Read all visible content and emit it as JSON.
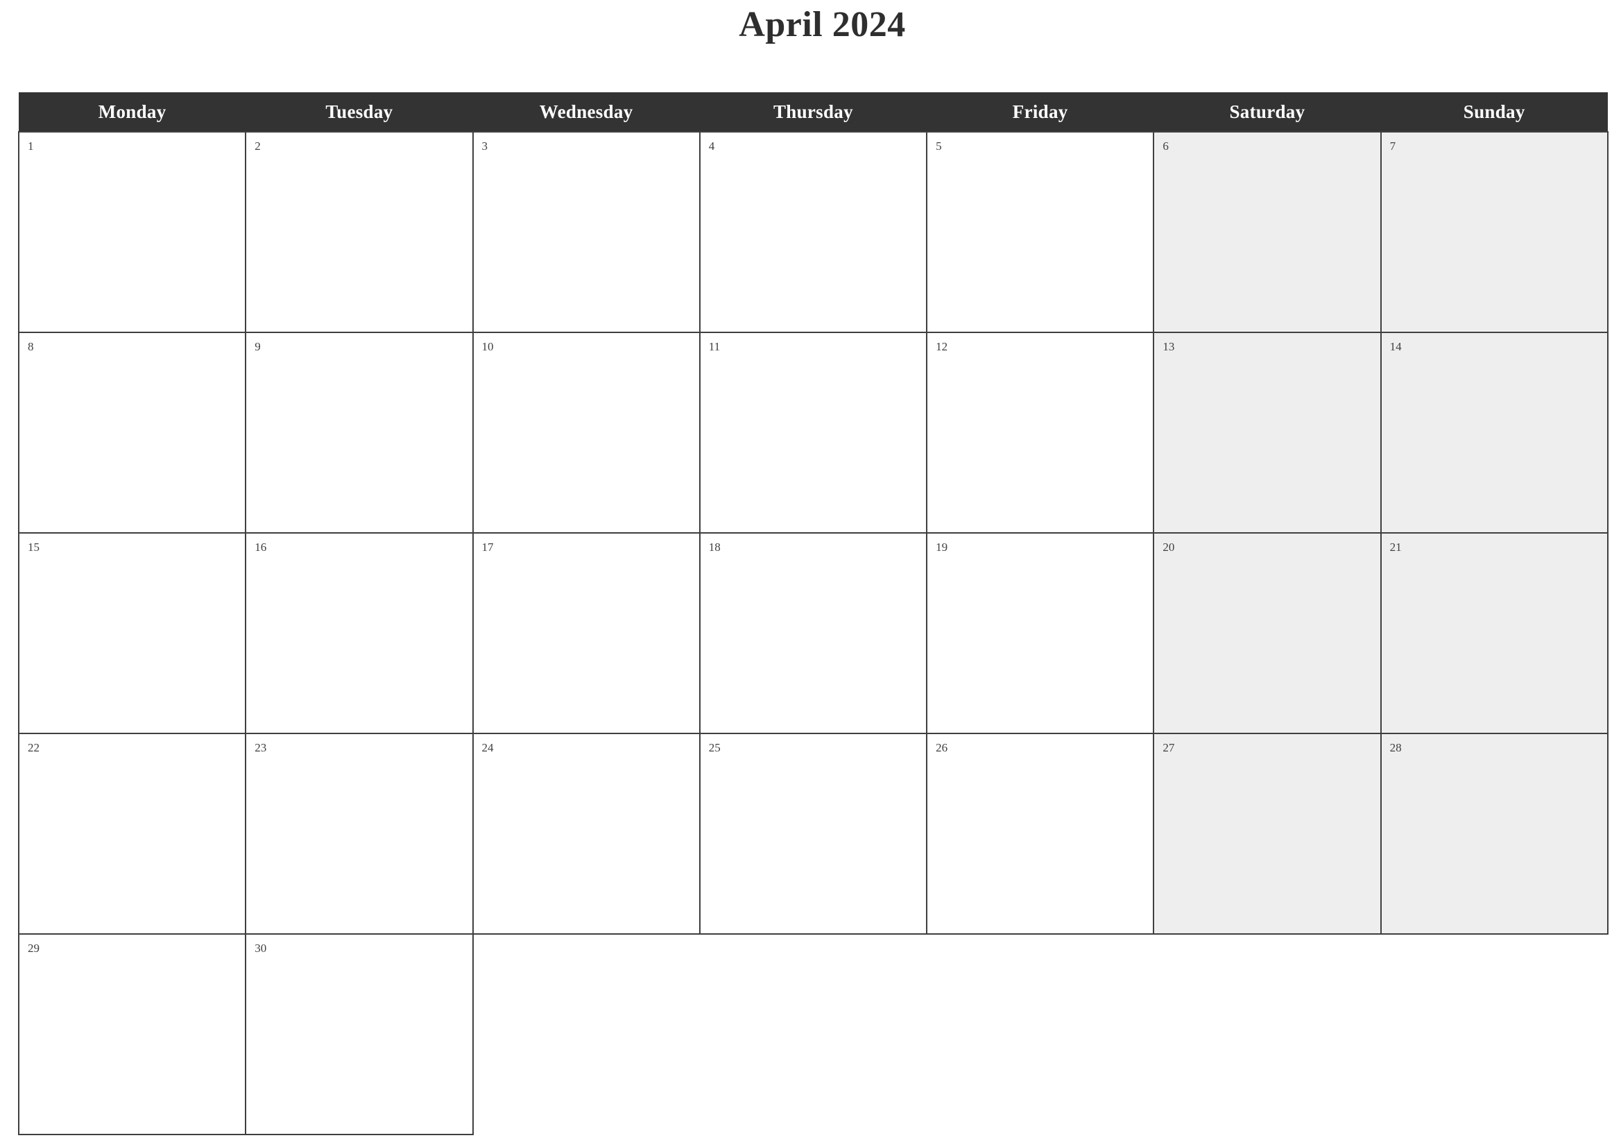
{
  "title": "April 2024",
  "month": "April",
  "year": "2024",
  "colors": {
    "header_background": "#333333",
    "header_text": "#ffffff",
    "weekend_background": "#eeeeee",
    "weekday_background": "#ffffff",
    "border": "#3f3f3f",
    "title_text": "#2e2e2e",
    "day_number_text": "#404040",
    "page_background": "#ffffff"
  },
  "weekday_headers": [
    {
      "label": "Monday",
      "weekend": false
    },
    {
      "label": "Tuesday",
      "weekend": false
    },
    {
      "label": "Wednesday",
      "weekend": false
    },
    {
      "label": "Thursday",
      "weekend": false
    },
    {
      "label": "Friday",
      "weekend": false
    },
    {
      "label": "Saturday",
      "weekend": true
    },
    {
      "label": "Sunday",
      "weekend": true
    }
  ],
  "weeks": [
    {
      "index": 1,
      "days": [
        {
          "number": "1",
          "weekend": false,
          "blank": false
        },
        {
          "number": "2",
          "weekend": false,
          "blank": false
        },
        {
          "number": "3",
          "weekend": false,
          "blank": false
        },
        {
          "number": "4",
          "weekend": false,
          "blank": false
        },
        {
          "number": "5",
          "weekend": false,
          "blank": false
        },
        {
          "number": "6",
          "weekend": true,
          "blank": false
        },
        {
          "number": "7",
          "weekend": true,
          "blank": false
        }
      ]
    },
    {
      "index": 2,
      "days": [
        {
          "number": "8",
          "weekend": false,
          "blank": false
        },
        {
          "number": "9",
          "weekend": false,
          "blank": false
        },
        {
          "number": "10",
          "weekend": false,
          "blank": false
        },
        {
          "number": "11",
          "weekend": false,
          "blank": false
        },
        {
          "number": "12",
          "weekend": false,
          "blank": false
        },
        {
          "number": "13",
          "weekend": true,
          "blank": false
        },
        {
          "number": "14",
          "weekend": true,
          "blank": false
        }
      ]
    },
    {
      "index": 3,
      "days": [
        {
          "number": "15",
          "weekend": false,
          "blank": false
        },
        {
          "number": "16",
          "weekend": false,
          "blank": false
        },
        {
          "number": "17",
          "weekend": false,
          "blank": false
        },
        {
          "number": "18",
          "weekend": false,
          "blank": false
        },
        {
          "number": "19",
          "weekend": false,
          "blank": false
        },
        {
          "number": "20",
          "weekend": true,
          "blank": false
        },
        {
          "number": "21",
          "weekend": true,
          "blank": false
        }
      ]
    },
    {
      "index": 4,
      "days": [
        {
          "number": "22",
          "weekend": false,
          "blank": false
        },
        {
          "number": "23",
          "weekend": false,
          "blank": false
        },
        {
          "number": "24",
          "weekend": false,
          "blank": false
        },
        {
          "number": "25",
          "weekend": false,
          "blank": false
        },
        {
          "number": "26",
          "weekend": false,
          "blank": false
        },
        {
          "number": "27",
          "weekend": true,
          "blank": false
        },
        {
          "number": "28",
          "weekend": true,
          "blank": false
        }
      ]
    },
    {
      "index": 5,
      "days": [
        {
          "number": "29",
          "weekend": false,
          "blank": false
        },
        {
          "number": "30",
          "weekend": false,
          "blank": false
        },
        {
          "number": "",
          "weekend": false,
          "blank": true
        },
        {
          "number": "",
          "weekend": false,
          "blank": true
        },
        {
          "number": "",
          "weekend": false,
          "blank": true
        },
        {
          "number": "",
          "weekend": true,
          "blank": true
        },
        {
          "number": "",
          "weekend": true,
          "blank": true
        }
      ]
    }
  ]
}
